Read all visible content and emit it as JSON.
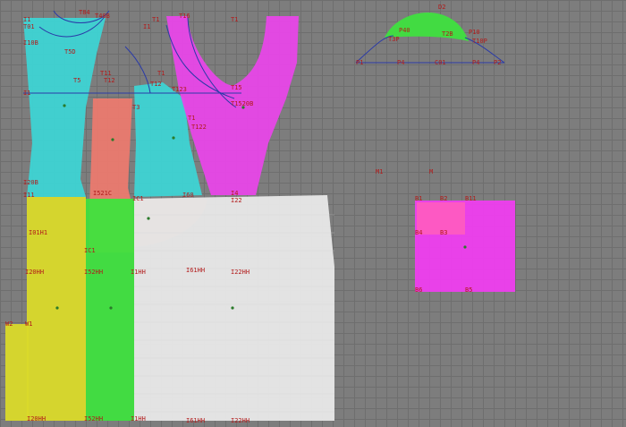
{
  "labels": {
    "tl_1": "I1",
    "tl_2": "T01",
    "tl_3": "I10B",
    "tl_4": "T84",
    "tl_5": "T40B",
    "tl_6": "T5D",
    "tl_7": "T5",
    "tl_8": "I1",
    "tl_9": "T11",
    "tl_10": "T12",
    "tl_11": "I1",
    "tl_12": "T1",
    "tl_13": "T16",
    "tl_14": "T1",
    "tl_15": "T1",
    "tl_16": "T12",
    "tl_17": "T123",
    "tl_18": "T15",
    "tl_19": "T1520B",
    "tl_20": "T3",
    "tl_21": "T1",
    "tl_22": "T122",
    "tl_23": "I20B",
    "tl_24": "I11",
    "tl_25": "I521C",
    "tl_26": "IC1",
    "tl_27": "I60",
    "tl_28": "I4",
    "tl_29": "I22",
    "tl_30": "I01H1",
    "tl_31": "IC1",
    "tl_32": "I20HH",
    "tl_33": "I52HH",
    "tl_34": "I1HH",
    "tl_35": "I61HH",
    "tl_36": "I22HH",
    "tl_37": "W1",
    "tl_38": "W2",
    "tl_39": "I20HH",
    "tl_40": "I52HH",
    "tl_41": "I1HH",
    "tl_42": "I61HH",
    "tl_43": "I22HH",
    "cl_1": "D2",
    "cl_2": "P40",
    "cl_3": "P10",
    "cl_4": "T3P",
    "cl_5": "T2B",
    "cl_6": "T10P",
    "cl_7": "P1",
    "cl_8": "P4",
    "cl_9": "C01",
    "cl_10": "P4",
    "cl_11": "P2",
    "cl_12": "M1",
    "cl_13": "M",
    "cl_14": "B1",
    "cl_15": "B2",
    "cl_16": "B11",
    "cl_17": "B4",
    "cl_18": "B3",
    "cl_19": "B6",
    "cl_20": "B5"
  },
  "colors": {
    "cyan": "#3cd6d6",
    "magenta": "#ea44ea",
    "salmon": "#ee7a6e",
    "yellow": "#dada2a",
    "green": "#3fe03f",
    "white": "#e6e6e6",
    "orange": "#e8a050",
    "pinkbox": "#f23cf2",
    "hotpink": "#ff5cbf",
    "blueline": "#2a3aa8"
  },
  "icons": {
    "node_marker": "dot-marker-icon"
  }
}
